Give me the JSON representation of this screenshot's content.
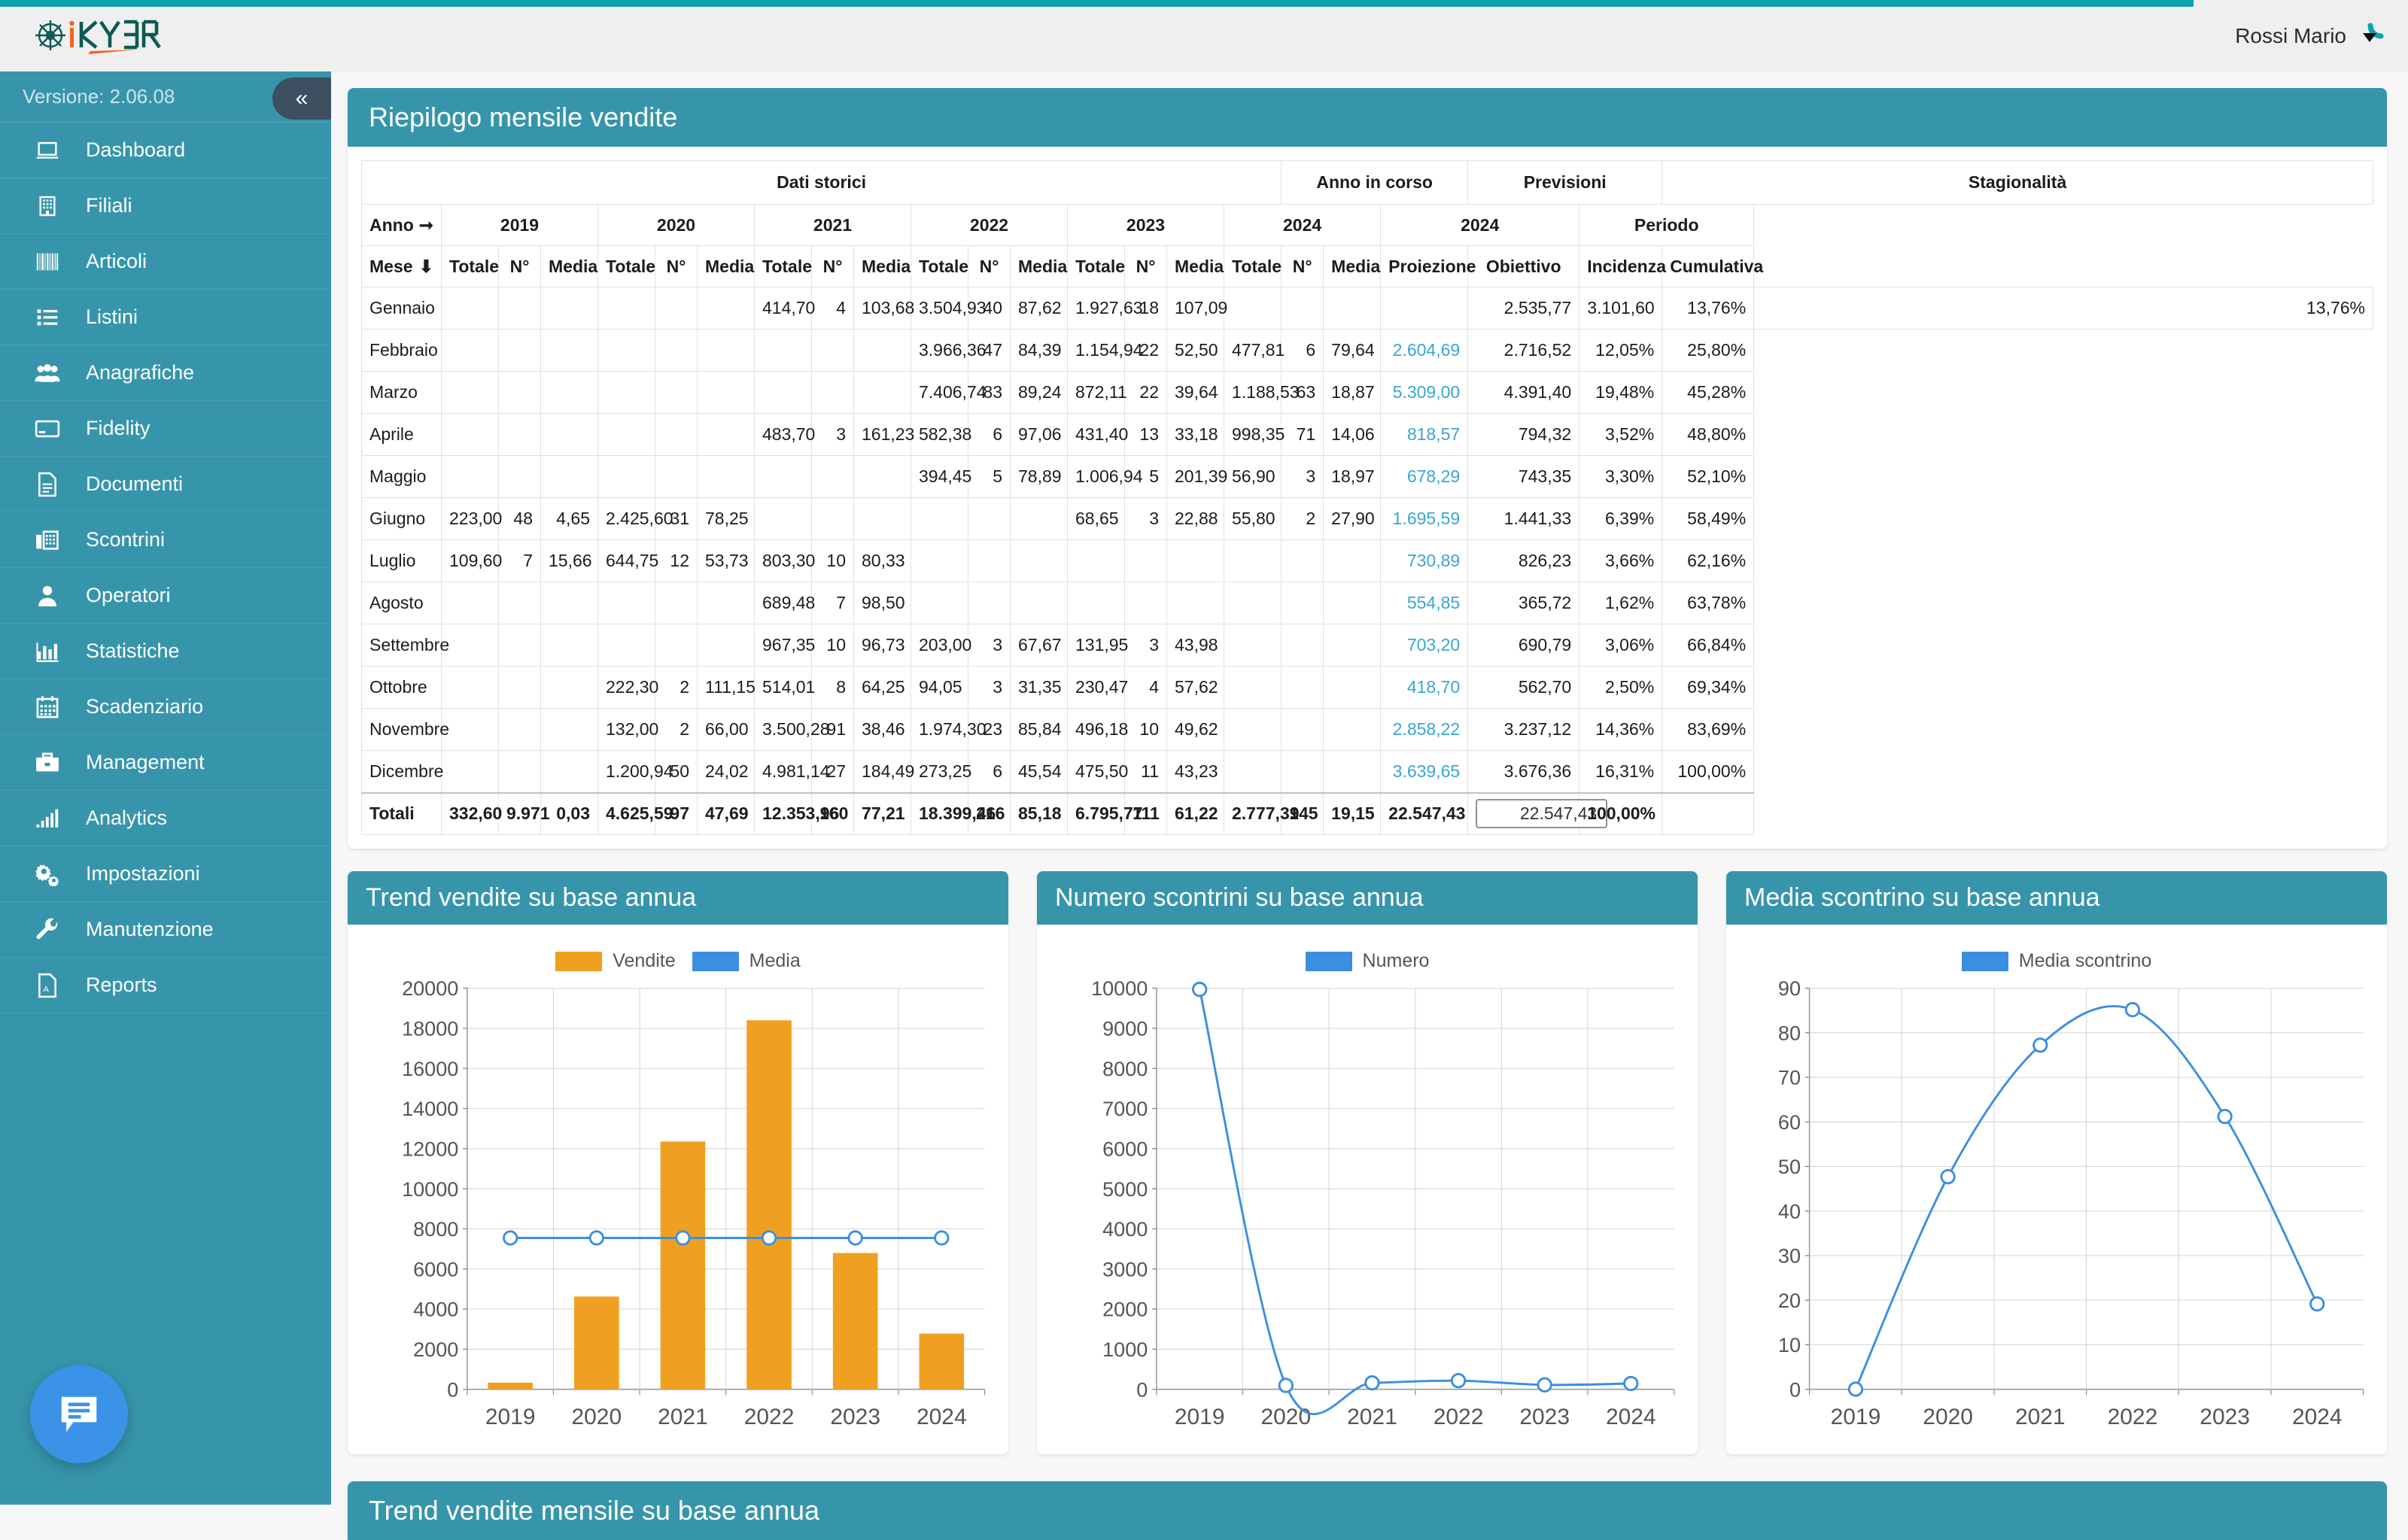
{
  "app": {
    "logo_text": "iKYBER",
    "version_label": "Versione: 2.06.08",
    "collapse_icon": "chevrons-left-icon",
    "user_name": "Rossi Mario",
    "user_caret_icon": "caret-down-icon",
    "chat_icon": "chat-bubble-icon"
  },
  "sidebar": {
    "items": [
      {
        "label": "Dashboard",
        "icon": "laptop-icon"
      },
      {
        "label": "Filiali",
        "icon": "building-icon"
      },
      {
        "label": "Articoli",
        "icon": "barcode-icon"
      },
      {
        "label": "Listini",
        "icon": "list-icon"
      },
      {
        "label": "Anagrafiche",
        "icon": "users-icon"
      },
      {
        "label": "Fidelity",
        "icon": "credit-card-icon"
      },
      {
        "label": "Documenti",
        "icon": "document-icon"
      },
      {
        "label": "Scontrini",
        "icon": "receipt-printer-icon"
      },
      {
        "label": "Operatori",
        "icon": "user-icon"
      },
      {
        "label": "Statistiche",
        "icon": "bar-chart-icon"
      },
      {
        "label": "Scadenziario",
        "icon": "calendar-icon"
      },
      {
        "label": "Management",
        "icon": "briefcase-icon"
      },
      {
        "label": "Analytics",
        "icon": "signal-bars-icon"
      },
      {
        "label": "Impostazioni",
        "icon": "gears-icon"
      },
      {
        "label": "Manutenzione",
        "icon": "wrench-icon"
      },
      {
        "label": "Reports",
        "icon": "pdf-file-icon"
      }
    ]
  },
  "summary_panel": {
    "title": "Riepilogo mensile vendite",
    "group_headers": [
      {
        "label": "Dati storici",
        "span": 15
      },
      {
        "label": "Anno in corso",
        "span": 3
      },
      {
        "label": "Previsioni",
        "span": 2
      },
      {
        "label": "Stagionalità",
        "span": 2
      }
    ],
    "year_row_label": "Anno",
    "year_row_icon": "arrow-right-icon",
    "year_headers": [
      {
        "label": "2019",
        "span": 3
      },
      {
        "label": "2020",
        "span": 3
      },
      {
        "label": "2021",
        "span": 3
      },
      {
        "label": "2022",
        "span": 3
      },
      {
        "label": "2023",
        "span": 3
      },
      {
        "label": "2024",
        "span": 3
      },
      {
        "label": "2024",
        "span": 2
      },
      {
        "label": "Periodo",
        "span": 2
      }
    ],
    "month_row_label": "Mese",
    "month_row_icon": "arrow-down-icon",
    "columns": [
      "Totale",
      "N°",
      "Media",
      "Totale",
      "N°",
      "Media",
      "Totale",
      "N°",
      "Media",
      "Totale",
      "N°",
      "Media",
      "Totale",
      "N°",
      "Media",
      "Totale",
      "N°",
      "Media",
      "Proiezione",
      "Obiettivo",
      "Incidenza",
      "Cumulativa"
    ],
    "rows": [
      {
        "mese": "Gennaio",
        "cells": [
          "",
          "",
          "",
          "",
          "",
          "",
          "414,70",
          "4",
          "103,68",
          "3.504,93",
          "40",
          "87,62",
          "1.927,63",
          "18",
          "107,09",
          "",
          "",
          "",
          "",
          "2.535,77",
          "3.101,60",
          "13,76%",
          "13,76%"
        ]
      },
      {
        "mese": "Febbraio",
        "cells": [
          "",
          "",
          "",
          "",
          "",
          "",
          "",
          "",
          "",
          "3.966,36",
          "47",
          "84,39",
          "1.154,94",
          "22",
          "52,50",
          "477,81",
          "6",
          "79,64",
          "2.604,69",
          "2.716,52",
          "12,05%",
          "25,80%"
        ]
      },
      {
        "mese": "Marzo",
        "cells": [
          "",
          "",
          "",
          "",
          "",
          "",
          "",
          "",
          "",
          "7.406,74",
          "83",
          "89,24",
          "872,11",
          "22",
          "39,64",
          "1.188,53",
          "63",
          "18,87",
          "5.309,00",
          "4.391,40",
          "19,48%",
          "45,28%"
        ]
      },
      {
        "mese": "Aprile",
        "cells": [
          "",
          "",
          "",
          "",
          "",
          "",
          "483,70",
          "3",
          "161,23",
          "582,38",
          "6",
          "97,06",
          "431,40",
          "13",
          "33,18",
          "998,35",
          "71",
          "14,06",
          "818,57",
          "794,32",
          "3,52%",
          "48,80%"
        ]
      },
      {
        "mese": "Maggio",
        "cells": [
          "",
          "",
          "",
          "",
          "",
          "",
          "",
          "",
          "",
          "394,45",
          "5",
          "78,89",
          "1.006,94",
          "5",
          "201,39",
          "56,90",
          "3",
          "18,97",
          "678,29",
          "743,35",
          "3,30%",
          "52,10%"
        ]
      },
      {
        "mese": "Giugno",
        "cells": [
          "223,00",
          "48",
          "4,65",
          "2.425,60",
          "31",
          "78,25",
          "",
          "",
          "",
          "",
          "",
          "",
          "68,65",
          "3",
          "22,88",
          "55,80",
          "2",
          "27,90",
          "1.695,59",
          "1.441,33",
          "6,39%",
          "58,49%"
        ]
      },
      {
        "mese": "Luglio",
        "cells": [
          "109,60",
          "7",
          "15,66",
          "644,75",
          "12",
          "53,73",
          "803,30",
          "10",
          "80,33",
          "",
          "",
          "",
          "",
          "",
          "",
          "",
          "",
          "",
          "730,89",
          "826,23",
          "3,66%",
          "62,16%"
        ]
      },
      {
        "mese": "Agosto",
        "cells": [
          "",
          "",
          "",
          "",
          "",
          "",
          "689,48",
          "7",
          "98,50",
          "",
          "",
          "",
          "",
          "",
          "",
          "",
          "",
          "",
          "554,85",
          "365,72",
          "1,62%",
          "63,78%"
        ]
      },
      {
        "mese": "Settembre",
        "cells": [
          "",
          "",
          "",
          "",
          "",
          "",
          "967,35",
          "10",
          "96,73",
          "203,00",
          "3",
          "67,67",
          "131,95",
          "3",
          "43,98",
          "",
          "",
          "",
          "703,20",
          "690,79",
          "3,06%",
          "66,84%"
        ]
      },
      {
        "mese": "Ottobre",
        "cells": [
          "",
          "",
          "",
          "222,30",
          "2",
          "111,15",
          "514,01",
          "8",
          "64,25",
          "94,05",
          "3",
          "31,35",
          "230,47",
          "4",
          "57,62",
          "",
          "",
          "",
          "418,70",
          "562,70",
          "2,50%",
          "69,34%"
        ]
      },
      {
        "mese": "Novembre",
        "cells": [
          "",
          "",
          "",
          "132,00",
          "2",
          "66,00",
          "3.500,28",
          "91",
          "38,46",
          "1.974,30",
          "23",
          "85,84",
          "496,18",
          "10",
          "49,62",
          "",
          "",
          "",
          "2.858,22",
          "3.237,12",
          "14,36%",
          "83,69%"
        ]
      },
      {
        "mese": "Dicembre",
        "cells": [
          "",
          "",
          "",
          "1.200,94",
          "50",
          "24,02",
          "4.981,14",
          "27",
          "184,49",
          "273,25",
          "6",
          "45,54",
          "475,50",
          "11",
          "43,23",
          "",
          "",
          "",
          "3.639,65",
          "3.676,36",
          "16,31%",
          "100,00%"
        ]
      }
    ],
    "totals": {
      "label": "Totali",
      "cells": [
        "332,60",
        "9.971",
        "0,03",
        "4.625,59",
        "97",
        "47,69",
        "12.353,96",
        "160",
        "77,21",
        "18.399,46",
        "216",
        "85,18",
        "6.795,77",
        "111",
        "61,22",
        "2.777,39",
        "145",
        "19,15",
        "22.547,43"
      ],
      "obiettivo_input_value": "22.547,43",
      "incidenza": "100,00%",
      "cumulativa": ""
    }
  },
  "charts": [
    {
      "title": "Trend vendite su base annua",
      "chart_data": {
        "type": "bar",
        "title": "Trend vendite su base annua",
        "categories": [
          "2019",
          "2020",
          "2021",
          "2022",
          "2023",
          "2024"
        ],
        "series": [
          {
            "name": "Vendite",
            "type": "bar",
            "color": "#f0a020",
            "values": [
              332.6,
              4625.59,
              12353.96,
              18399.46,
              6795.77,
              2777.39
            ]
          },
          {
            "name": "Media",
            "type": "line",
            "color": "#3b8fe0",
            "values": [
              7547.46,
              7547.46,
              7547.46,
              7547.46,
              7547.46,
              7547.46
            ]
          }
        ],
        "xlabel": "",
        "ylabel": "",
        "ylim": [
          0,
          20000
        ],
        "yticks": [
          0,
          2000,
          4000,
          6000,
          8000,
          10000,
          12000,
          14000,
          16000,
          18000,
          20000
        ],
        "grid": true,
        "legend": "top"
      }
    },
    {
      "title": "Numero scontrini su base annua",
      "chart_data": {
        "type": "line",
        "title": "Numero scontrini su base annua",
        "categories": [
          "2019",
          "2020",
          "2021",
          "2022",
          "2023",
          "2024"
        ],
        "series": [
          {
            "name": "Numero",
            "color": "#3b8fe0",
            "values": [
              9971,
              97,
              160,
              216,
              111,
              145
            ]
          }
        ],
        "xlabel": "",
        "ylabel": "",
        "ylim": [
          0,
          10000
        ],
        "yticks": [
          0,
          1000,
          2000,
          3000,
          4000,
          5000,
          6000,
          7000,
          8000,
          9000,
          10000
        ],
        "grid": true,
        "legend": "top"
      }
    },
    {
      "title": "Media scontrino su base annua",
      "chart_data": {
        "type": "line",
        "title": "Media scontrino su base annua",
        "categories": [
          "2019",
          "2020",
          "2021",
          "2022",
          "2023",
          "2024"
        ],
        "series": [
          {
            "name": "Media scontrino",
            "color": "#3b8fe0",
            "values": [
              0.03,
              47.69,
              77.21,
              85.18,
              61.22,
              19.15
            ]
          }
        ],
        "xlabel": "",
        "ylabel": "",
        "ylim": [
          0,
          90
        ],
        "yticks": [
          0,
          10,
          20,
          30,
          40,
          50,
          60,
          70,
          80,
          90
        ],
        "grid": true,
        "legend": "top"
      }
    }
  ],
  "bottom_panel": {
    "title": "Trend vendite mensile su base annua"
  },
  "colors": {
    "brand_teal": "#3795ab",
    "top_accent": "#0aa2ad",
    "orange": "#f0a020",
    "blue": "#3b8fe0",
    "projection_blue": "#3aa5d2"
  }
}
